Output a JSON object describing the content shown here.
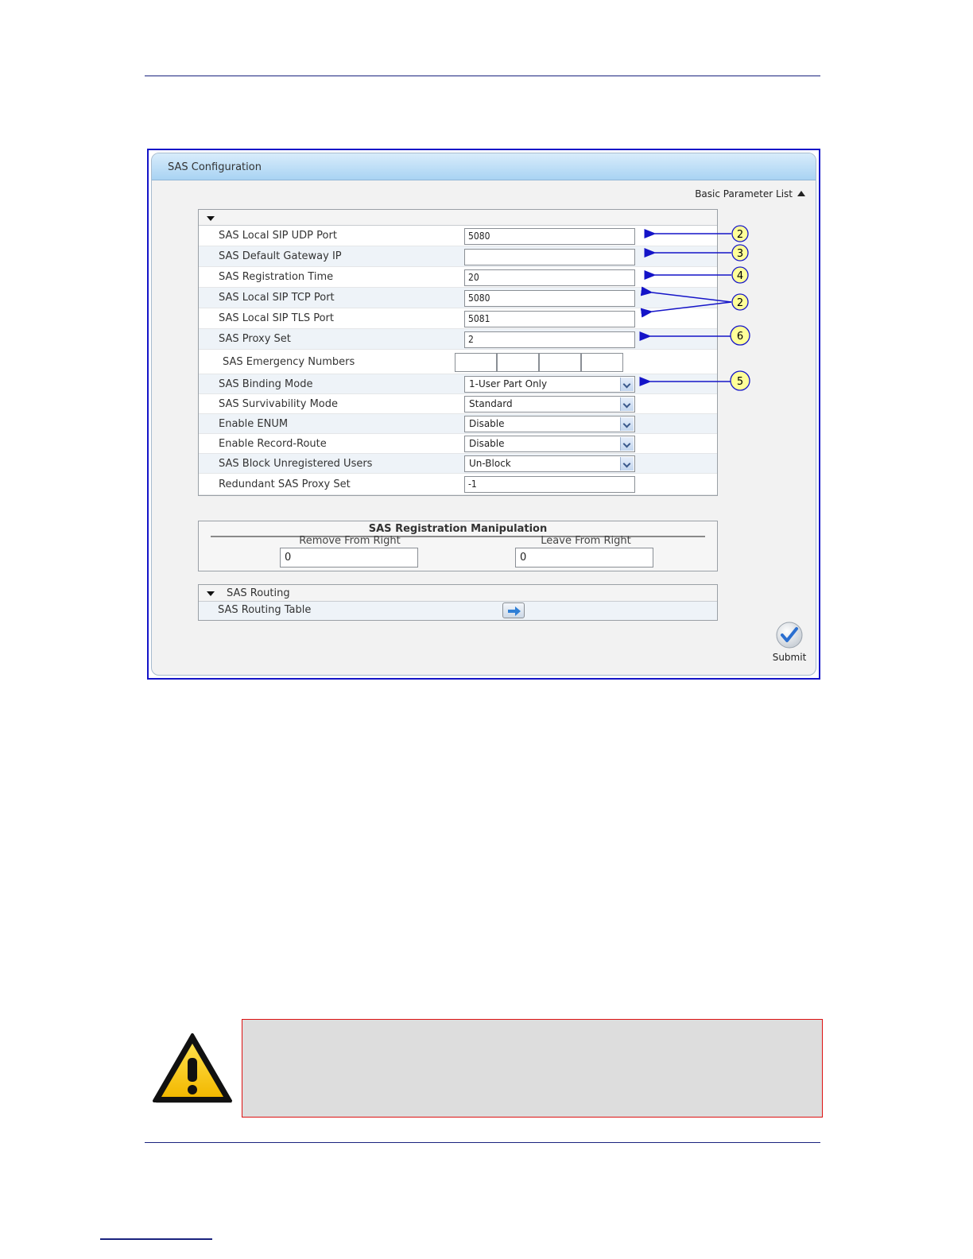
{
  "panel": {
    "title": "SAS Configuration",
    "basic_parameter_list": "Basic Parameter List",
    "submit_label": "Submit"
  },
  "params": [
    {
      "label": "SAS Local SIP UDP Port",
      "type": "text",
      "value": "5080"
    },
    {
      "label": "SAS Default Gateway IP",
      "type": "text",
      "value": ""
    },
    {
      "label": "SAS Registration Time",
      "type": "text",
      "value": "20"
    },
    {
      "label": "SAS Local SIP TCP Port",
      "type": "text",
      "value": "5080"
    },
    {
      "label": "SAS Local SIP TLS Port",
      "type": "text",
      "value": "5081"
    },
    {
      "label": "SAS Proxy Set",
      "type": "text",
      "value": "2"
    },
    {
      "label": "SAS Emergency Numbers",
      "type": "multi",
      "values": [
        "",
        "",
        "",
        ""
      ]
    },
    {
      "label": "SAS Binding Mode",
      "type": "select",
      "value": "1-User Part Only"
    },
    {
      "label": "SAS Survivability Mode",
      "type": "select",
      "value": "Standard"
    },
    {
      "label": "Enable ENUM",
      "type": "select",
      "value": "Disable"
    },
    {
      "label": "Enable Record-Route",
      "type": "select",
      "value": "Disable"
    },
    {
      "label": "SAS Block Unregistered Users",
      "type": "select",
      "value": "Un-Block"
    },
    {
      "label": "Redundant SAS Proxy Set",
      "type": "text",
      "value": "-1"
    }
  ],
  "manipulation": {
    "title": "SAS Registration Manipulation",
    "remove_label": "Remove From Right",
    "remove_value": "0",
    "leave_label": "Leave From Right",
    "leave_value": "0"
  },
  "routing": {
    "section_label": "SAS Routing",
    "table_label": "SAS Routing Table"
  },
  "callouts": [
    "2",
    "3",
    "4",
    "2",
    "6",
    "5"
  ],
  "colors": {
    "callout_blue": "#1414c8",
    "callout_fill": "#ffff99",
    "note_border": "#dd1111",
    "rule": "#1a237e"
  }
}
